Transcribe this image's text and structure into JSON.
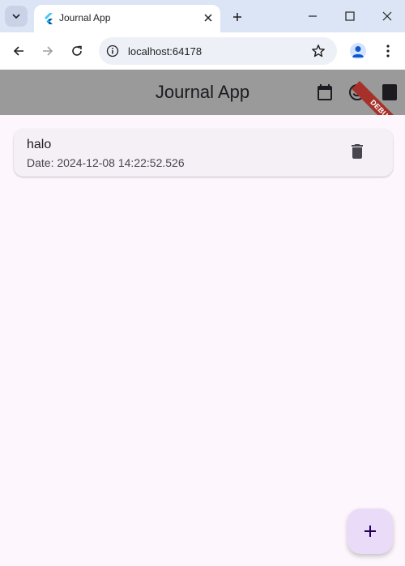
{
  "browser": {
    "tab_title": "Journal App",
    "url": "localhost:64178"
  },
  "app": {
    "title": "Journal App",
    "debug_label": "DEBUG",
    "appbar_icons": [
      "calendar-icon",
      "emoji-icon",
      "book-icon"
    ],
    "entries": [
      {
        "title": "halo",
        "date": "Date: 2024-12-08 14:22:52.526"
      }
    ],
    "fab_icon": "add-icon"
  },
  "colors": {
    "appbar": "#9a9a9a",
    "background": "#fdf7fd",
    "card": "#f5eff6",
    "fab": "#eadcf8",
    "debug": "#a6312a",
    "tabstrip": "#dce5f5"
  }
}
